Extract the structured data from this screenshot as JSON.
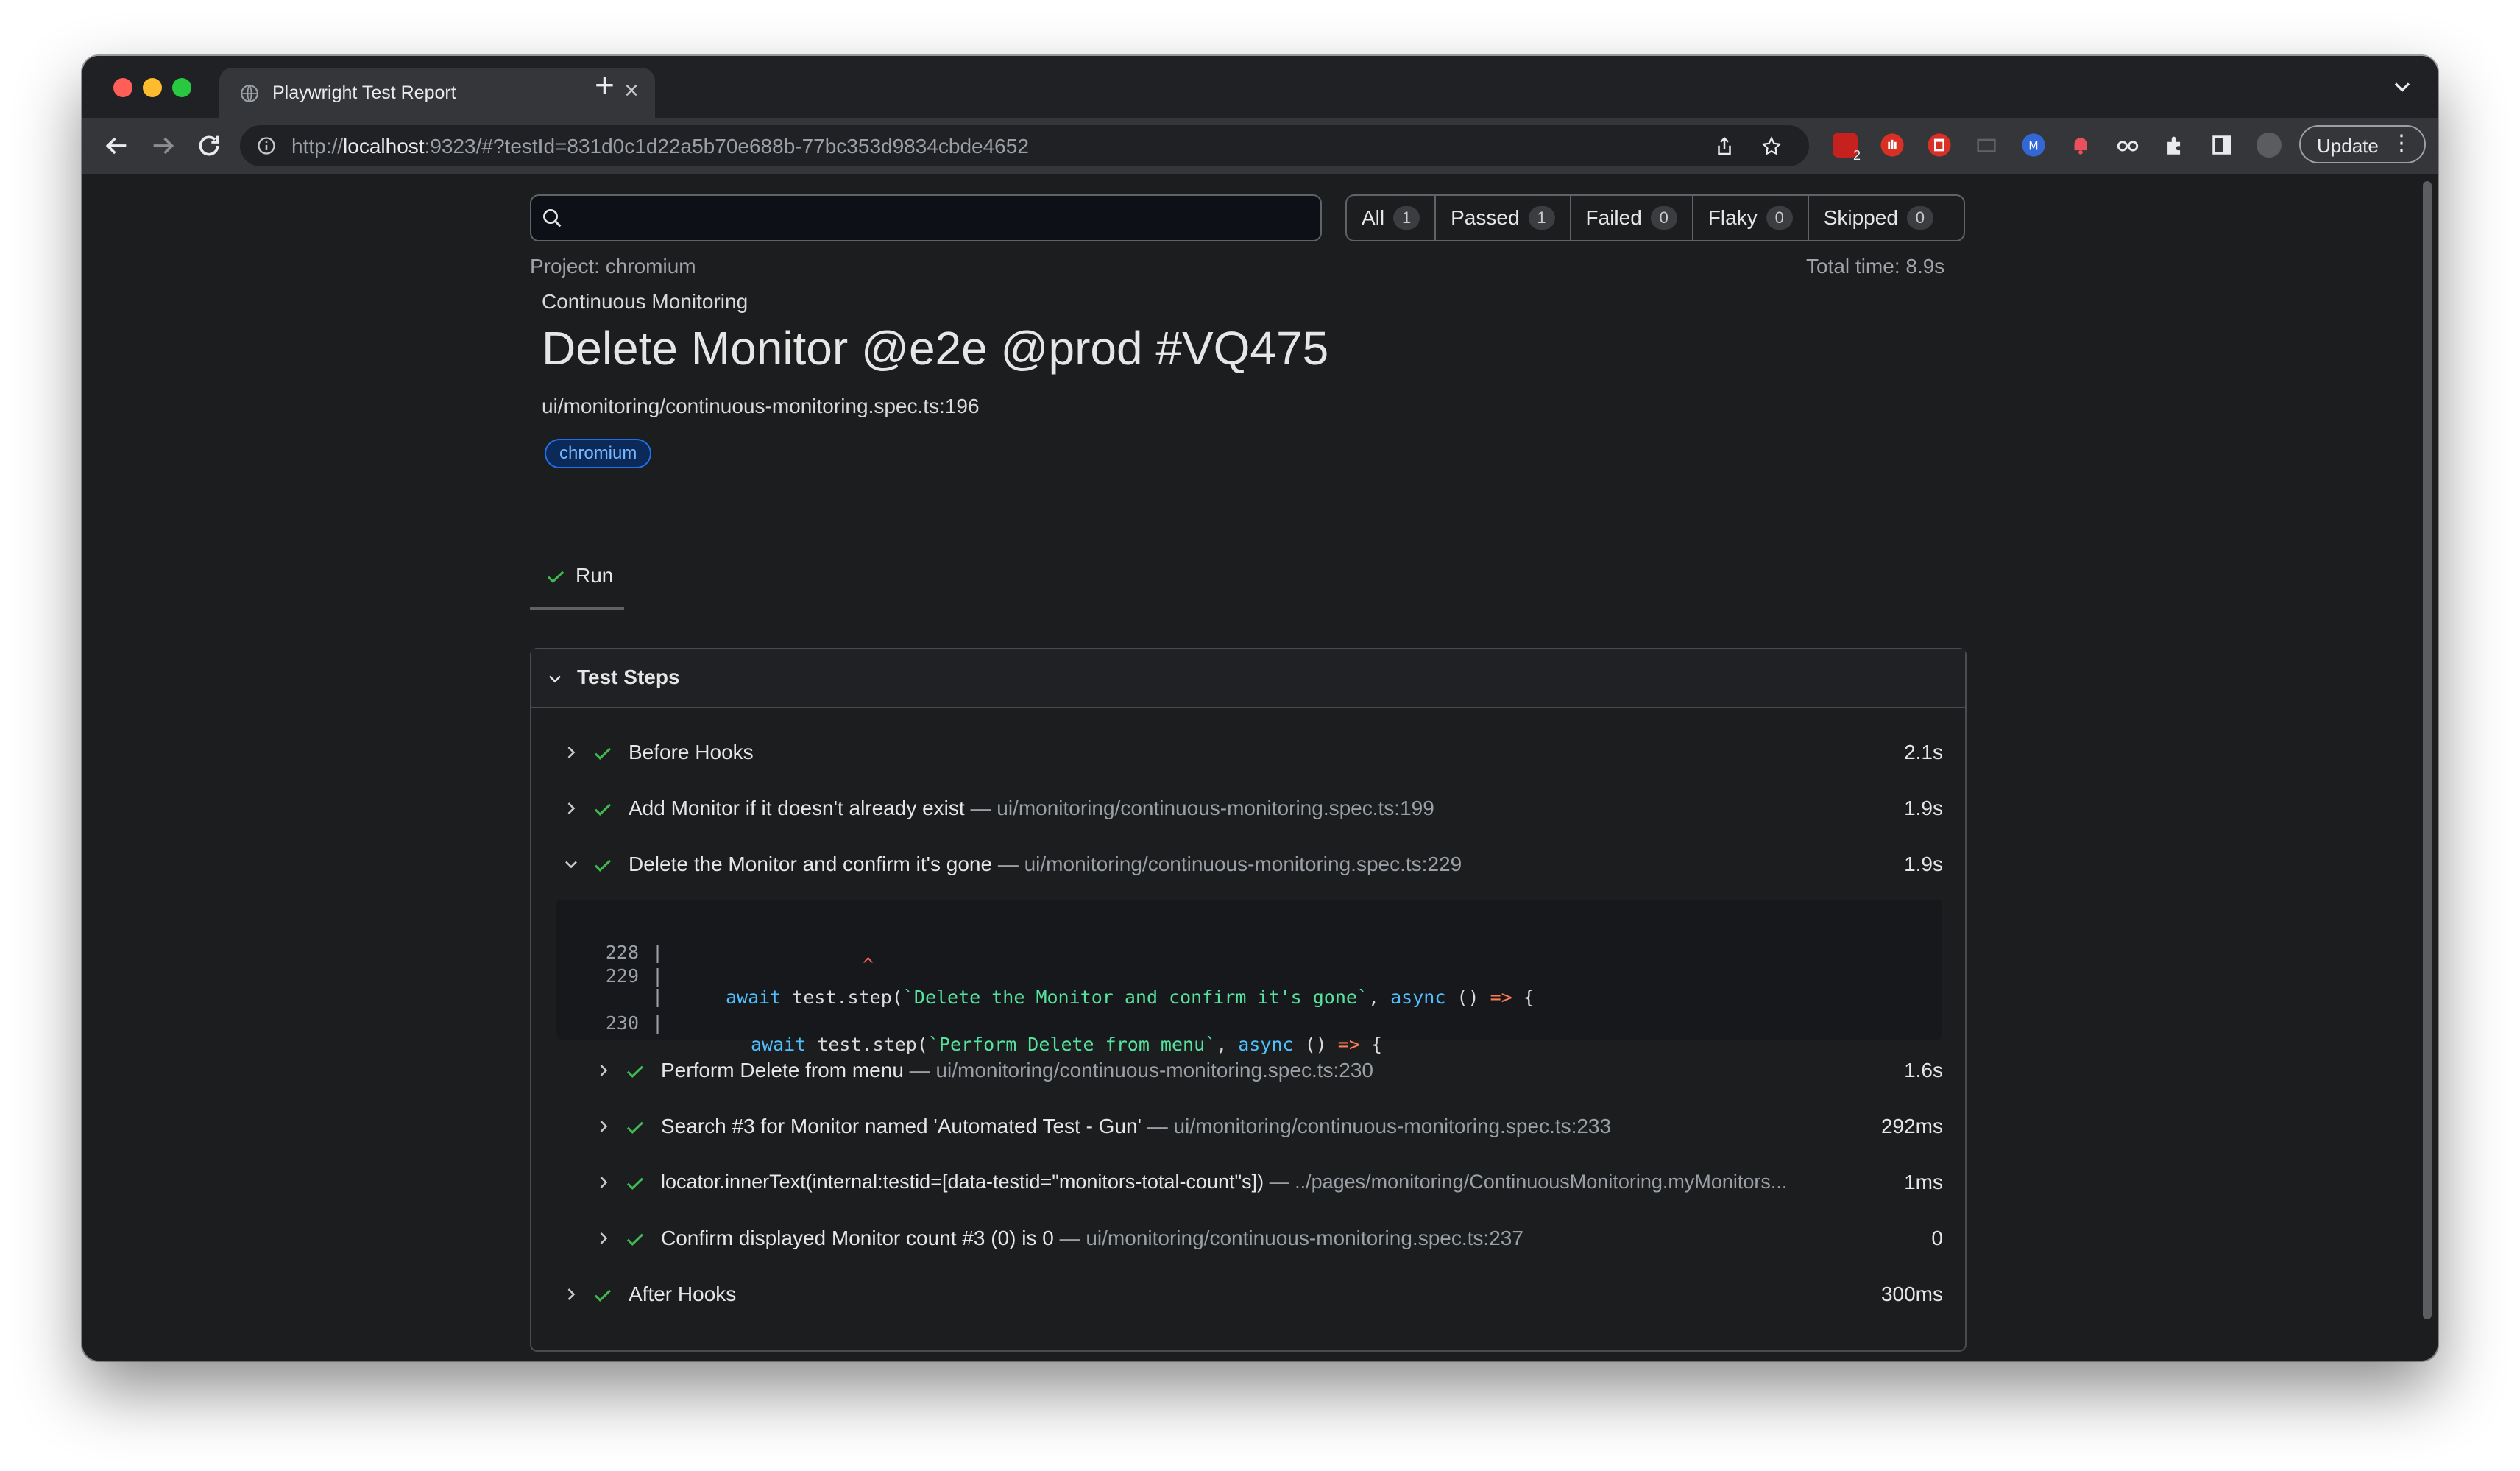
{
  "browser": {
    "tab_title": "Playwright Test Report",
    "url_prefix": "http://",
    "url_host": "localhost",
    "url_rest": ":9323/#?testId=831d0c1d22a5b70e688b-77bc353d9834cbde4652",
    "update_label": "Update",
    "ext_badge": "2"
  },
  "filters": [
    {
      "label": "All",
      "count": "1"
    },
    {
      "label": "Passed",
      "count": "1"
    },
    {
      "label": "Failed",
      "count": "0"
    },
    {
      "label": "Flaky",
      "count": "0"
    },
    {
      "label": "Skipped",
      "count": "0"
    }
  ],
  "report": {
    "project": "Project: chromium",
    "total_time": "Total time: 8.9s",
    "suite": "Continuous Monitoring",
    "title": "Delete Monitor @e2e @prod #VQ475",
    "file": "ui/monitoring/continuous-monitoring.spec.ts:196",
    "badge": "chromium",
    "run_tab": "Run"
  },
  "steps_panel": {
    "title": "Test Steps",
    "steps": [
      {
        "title": "Before Hooks",
        "location": "",
        "duration": "2.1s"
      },
      {
        "title": "Add Monitor if it doesn't already exist",
        "location": " — ui/monitoring/continuous-monitoring.spec.ts:199",
        "duration": "1.9s"
      },
      {
        "title": "Delete the Monitor and confirm it's gone",
        "location": " — ui/monitoring/continuous-monitoring.spec.ts:229",
        "duration": "1.9s"
      },
      {
        "title": "Perform Delete from menu",
        "location": " — ui/monitoring/continuous-monitoring.spec.ts:230",
        "duration": "1.6s"
      },
      {
        "title": "Search #3 for Monitor named 'Automated Test - Gun'",
        "location": " — ui/monitoring/continuous-monitoring.spec.ts:233",
        "duration": "292ms"
      },
      {
        "title": "locator.innerText(internal:testid=[data-testid=\"monitors-total-count\"s])",
        "location": " — ../pages/monitoring/ContinuousMonitoring.myMonitors...",
        "duration": "1ms"
      },
      {
        "title": "Confirm displayed Monitor count #3 (0) is 0",
        "location": " — ui/monitoring/continuous-monitoring.spec.ts:237",
        "duration": "0"
      },
      {
        "title": "After Hooks",
        "location": "",
        "duration": "300ms"
      }
    ],
    "code": {
      "line1_no": "228",
      "line2_no": "229",
      "line3_no": "230",
      "l2_await": "await",
      "l2_mid": " test.step(",
      "l2_str": "`Delete the Monitor and confirm it's gone`",
      "l2_comma": ", ",
      "l2_async": "async",
      "l2_paren": " () ",
      "l2_arrow": "=>",
      "l2_brace": " {",
      "caret": "^",
      "l3_await": "await",
      "l3_mid": " test.step(",
      "l3_str": "`Perform Delete from menu`",
      "l3_comma": ", ",
      "l3_async": "async",
      "l3_paren": " () ",
      "l3_arrow": "=>",
      "l3_brace": " {"
    }
  }
}
